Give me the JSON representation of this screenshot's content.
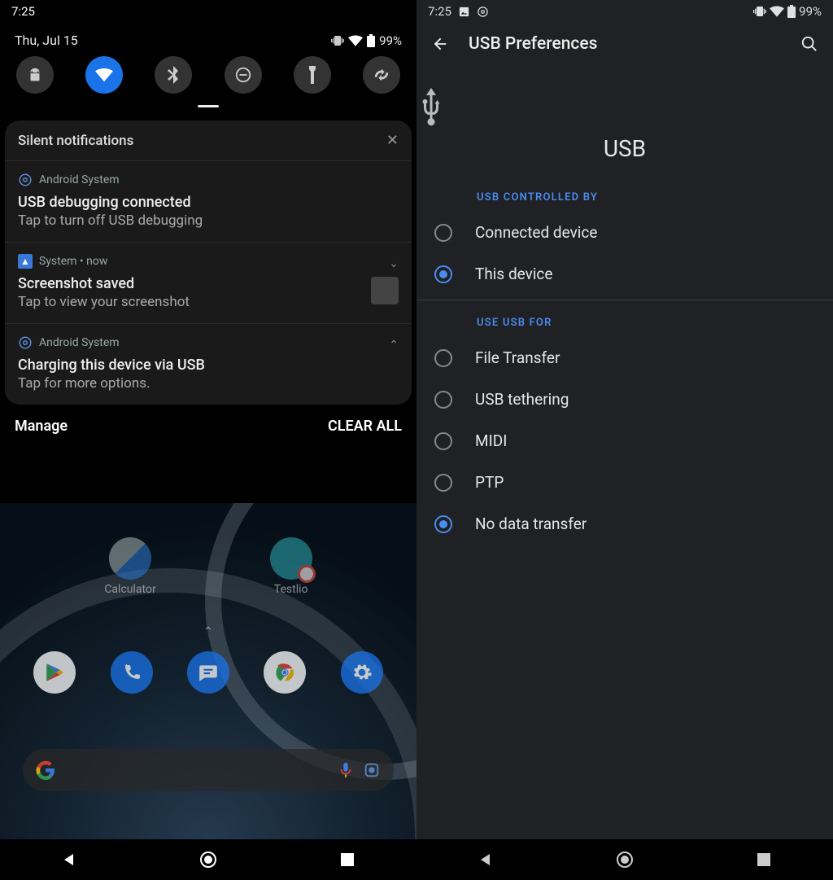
{
  "left": {
    "status": {
      "time": "7:25",
      "battery": "99%"
    },
    "qs": {
      "date": "Thu, Jul 15",
      "battery": "99%"
    },
    "silent_header": "Silent notifications",
    "notifs": [
      {
        "src": "Android System",
        "title": "USB debugging connected",
        "body": "Tap to turn off USB debugging"
      },
      {
        "src": "System • now",
        "title": "Screenshot saved",
        "body": "Tap to view your screenshot"
      },
      {
        "src": "Android System",
        "title": "Charging this device via USB",
        "body": "Tap for more options."
      }
    ],
    "manage": "Manage",
    "clear_all": "CLEAR ALL",
    "apps": {
      "calculator": "Calculator",
      "testlio": "Testlio"
    }
  },
  "right": {
    "status": {
      "time": "7:25",
      "battery": "99%"
    },
    "title": "USB Preferences",
    "hero": "USB",
    "section_controlled": "USB CONTROLLED BY",
    "controlled": [
      {
        "label": "Connected device",
        "selected": false
      },
      {
        "label": "This device",
        "selected": true
      }
    ],
    "section_use": "USE USB FOR",
    "use": [
      {
        "label": "File Transfer",
        "selected": false
      },
      {
        "label": "USB tethering",
        "selected": false
      },
      {
        "label": "MIDI",
        "selected": false
      },
      {
        "label": "PTP",
        "selected": false
      },
      {
        "label": "No data transfer",
        "selected": true
      }
    ]
  }
}
